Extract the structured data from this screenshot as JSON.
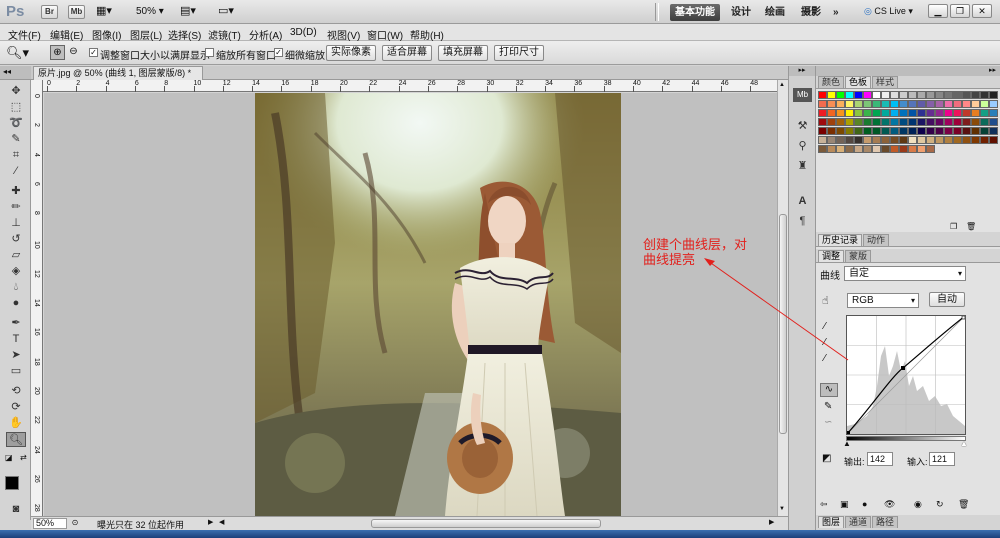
{
  "app": {
    "logo": "Ps",
    "bridge": "Br",
    "minibridge": "Mb",
    "zoom_select": "50%",
    "workspaces": [
      "基本功能",
      "设计",
      "绘画",
      "摄影"
    ],
    "more": "»",
    "cslive": "CS Live"
  },
  "menu": [
    "文件(F)",
    "编辑(E)",
    "图像(I)",
    "图层(L)",
    "选择(S)",
    "滤镜(T)",
    "分析(A)",
    "3D(D)",
    "视图(V)",
    "窗口(W)",
    "帮助(H)"
  ],
  "options": {
    "opt1": "调整窗口大小以满屏显示",
    "opt2": "缩放所有窗口",
    "opt3": "细微缩放",
    "btn_actual": "实际像素",
    "btn_fit": "适合屏幕",
    "btn_fill": "填充屏幕",
    "btn_print": "打印尺寸"
  },
  "document": {
    "tab_title": "原片.jpg @ 50% (曲线 1, 图层蒙版/8) *",
    "close": "×"
  },
  "rulers": {
    "h": [
      "0",
      "2",
      "4",
      "6",
      "8",
      "10",
      "12",
      "14",
      "16",
      "18",
      "20",
      "22",
      "24",
      "26",
      "28",
      "30",
      "32",
      "34",
      "36",
      "38",
      "40",
      "42",
      "44",
      "46",
      "48"
    ],
    "v": [
      "0",
      "2",
      "4",
      "6",
      "8",
      "10",
      "12",
      "14",
      "16",
      "18",
      "20",
      "22",
      "24",
      "26",
      "28"
    ]
  },
  "status": {
    "zoom": "50%",
    "info": "曝光只在 32 位起作用"
  },
  "annotation": {
    "line1": "创建个曲线层，对",
    "line2": "曲线提亮"
  },
  "panels": {
    "swatch_tabs": [
      "颜色",
      "色板",
      "样式"
    ],
    "history_tabs": [
      "历史记录",
      "动作"
    ],
    "adjust_tabs": [
      "调整",
      "蒙版"
    ],
    "curves_label": "曲线",
    "preset": "自定",
    "channel": "RGB",
    "auto": "自动",
    "output_label": "输出:",
    "output_value": "142",
    "input_label": "输入:",
    "input_value": "121",
    "layer_tabs": [
      "图层",
      "通道",
      "路径"
    ]
  },
  "colors": {
    "annotation": "#e2201c",
    "accent": "#3e3e3e"
  }
}
